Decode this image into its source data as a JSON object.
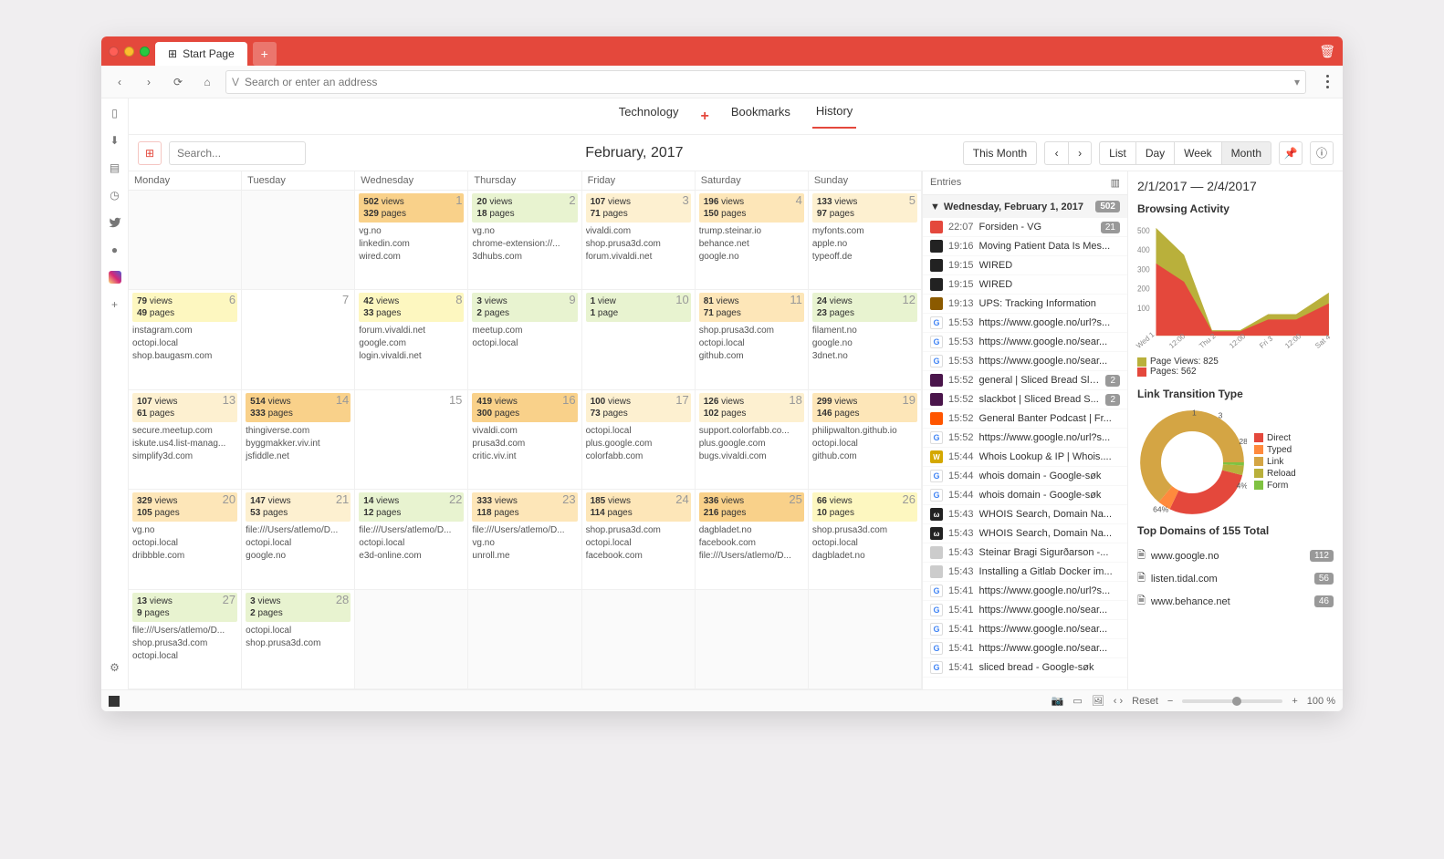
{
  "tab_title": "Start Page",
  "omnibox_placeholder": "Search or enter an address",
  "topnav": [
    "Technology",
    "Bookmarks",
    "History"
  ],
  "topnav_active": "History",
  "search_placeholder": "Search...",
  "month_title": "February, 2017",
  "this_month": "This Month",
  "view_modes": [
    "List",
    "Day",
    "Week",
    "Month"
  ],
  "view_active": "Month",
  "day_headers": [
    "Monday",
    "Tuesday",
    "Wednesday",
    "Thursday",
    "Friday",
    "Saturday",
    "Sunday"
  ],
  "days": [
    {
      "n": "",
      "empty": true
    },
    {
      "n": "",
      "empty": true
    },
    {
      "n": "1",
      "v": "502",
      "p": "329",
      "cls": "o1",
      "sites": [
        "vg.no",
        "linkedin.com",
        "wired.com"
      ]
    },
    {
      "n": "2",
      "v": "20",
      "p": "18",
      "cls": "g1",
      "sites": [
        "vg.no",
        "chrome-extension://...",
        "3dhubs.com"
      ]
    },
    {
      "n": "3",
      "v": "107",
      "p": "71",
      "cls": "o3",
      "sites": [
        "vivaldi.com",
        "shop.prusa3d.com",
        "forum.vivaldi.net"
      ]
    },
    {
      "n": "4",
      "v": "196",
      "p": "150",
      "cls": "o2",
      "sites": [
        "trump.steinar.io",
        "behance.net",
        "google.no"
      ]
    },
    {
      "n": "5",
      "v": "133",
      "p": "97",
      "cls": "o3",
      "sites": [
        "myfonts.com",
        "apple.no",
        "typeoff.de"
      ]
    },
    {
      "n": "6",
      "v": "79",
      "p": "49",
      "cls": "y1",
      "sites": [
        "instagram.com",
        "octopi.local",
        "shop.baugasm.com"
      ]
    },
    {
      "n": "7",
      "empty": true
    },
    {
      "n": "8",
      "v": "42",
      "p": "33",
      "cls": "y1",
      "sites": [
        "forum.vivaldi.net",
        "google.com",
        "login.vivaldi.net"
      ]
    },
    {
      "n": "9",
      "v": "3",
      "p": "2",
      "cls": "g1",
      "sites": [
        "meetup.com",
        "octopi.local"
      ]
    },
    {
      "n": "10",
      "v": "1",
      "p": "1",
      "cls": "g1",
      "sv": "view",
      "sp": "page",
      "sites": []
    },
    {
      "n": "11",
      "v": "81",
      "p": "71",
      "cls": "o2",
      "sites": [
        "shop.prusa3d.com",
        "octopi.local",
        "github.com"
      ]
    },
    {
      "n": "12",
      "v": "24",
      "p": "23",
      "cls": "g1",
      "sites": [
        "filament.no",
        "google.no",
        "3dnet.no"
      ]
    },
    {
      "n": "13",
      "v": "107",
      "p": "61",
      "cls": "o3",
      "sites": [
        "secure.meetup.com",
        "iskute.us4.list-manag...",
        "simplify3d.com"
      ]
    },
    {
      "n": "14",
      "v": "514",
      "p": "333",
      "cls": "o1",
      "sites": [
        "thingiverse.com",
        "byggmakker.viv.int",
        "jsfiddle.net"
      ]
    },
    {
      "n": "15",
      "empty": true
    },
    {
      "n": "16",
      "v": "419",
      "p": "300",
      "cls": "o1",
      "sites": [
        "vivaldi.com",
        "prusa3d.com",
        "critic.viv.int"
      ]
    },
    {
      "n": "17",
      "v": "100",
      "p": "73",
      "cls": "o3",
      "sites": [
        "octopi.local",
        "plus.google.com",
        "colorfabb.com"
      ]
    },
    {
      "n": "18",
      "v": "126",
      "p": "102",
      "cls": "o3",
      "sites": [
        "support.colorfabb.co...",
        "plus.google.com",
        "bugs.vivaldi.com"
      ]
    },
    {
      "n": "19",
      "v": "299",
      "p": "146",
      "cls": "o2",
      "sites": [
        "philipwalton.github.io",
        "octopi.local",
        "github.com"
      ]
    },
    {
      "n": "20",
      "v": "329",
      "p": "105",
      "cls": "o2",
      "sites": [
        "vg.no",
        "octopi.local",
        "dribbble.com"
      ]
    },
    {
      "n": "21",
      "v": "147",
      "p": "53",
      "cls": "o3",
      "sites": [
        "file:///Users/atlemo/D...",
        "octopi.local",
        "google.no"
      ]
    },
    {
      "n": "22",
      "v": "14",
      "p": "12",
      "cls": "g1",
      "sites": [
        "file:///Users/atlemo/D...",
        "octopi.local",
        "e3d-online.com"
      ]
    },
    {
      "n": "23",
      "v": "333",
      "p": "118",
      "cls": "o2",
      "sites": [
        "file:///Users/atlemo/D...",
        "vg.no",
        "unroll.me"
      ]
    },
    {
      "n": "24",
      "v": "185",
      "p": "114",
      "cls": "o2",
      "sites": [
        "shop.prusa3d.com",
        "octopi.local",
        "facebook.com"
      ]
    },
    {
      "n": "25",
      "v": "336",
      "p": "216",
      "cls": "o1",
      "sites": [
        "dagbladet.no",
        "facebook.com",
        "file:///Users/atlemo/D..."
      ]
    },
    {
      "n": "26",
      "v": "66",
      "p": "10",
      "cls": "y1",
      "sites": [
        "shop.prusa3d.com",
        "octopi.local",
        "dagbladet.no"
      ]
    },
    {
      "n": "27",
      "v": "13",
      "p": "9",
      "cls": "g1",
      "sites": [
        "file:///Users/atlemo/D...",
        "shop.prusa3d.com",
        "octopi.local"
      ]
    },
    {
      "n": "28",
      "v": "3",
      "p": "2",
      "cls": "g1",
      "sites": [
        "octopi.local",
        "shop.prusa3d.com"
      ]
    },
    {
      "n": "",
      "empty": true
    },
    {
      "n": "",
      "empty": true
    },
    {
      "n": "",
      "empty": true
    },
    {
      "n": "",
      "empty": true
    },
    {
      "n": "",
      "empty": true
    }
  ],
  "entries_header": "Entries",
  "entries_date": "Wednesday, February 1, 2017",
  "entries_count": "502",
  "entries": [
    {
      "t": "22:07",
      "title": "Forsiden - VG",
      "fav": "#e4483c",
      "badge": "21"
    },
    {
      "t": "19:16",
      "title": "Moving Patient Data Is Mes...",
      "fav": "#222"
    },
    {
      "t": "19:15",
      "title": "WIRED",
      "fav": "#222"
    },
    {
      "t": "19:15",
      "title": "WIRED",
      "fav": "#222"
    },
    {
      "t": "19:13",
      "title": "UPS: Tracking Information",
      "fav": "#8b5a00"
    },
    {
      "t": "15:53",
      "title": "https://www.google.no/url?s...",
      "fav": "g"
    },
    {
      "t": "15:53",
      "title": "https://www.google.no/sear...",
      "fav": "g"
    },
    {
      "t": "15:53",
      "title": "https://www.google.no/sear...",
      "fav": "g"
    },
    {
      "t": "15:52",
      "title": "general | Sliced Bread Sla...",
      "fav": "#4a154b",
      "badge": "2"
    },
    {
      "t": "15:52",
      "title": "slackbot | Sliced Bread S...",
      "fav": "#4a154b",
      "badge": "2"
    },
    {
      "t": "15:52",
      "title": "General Banter Podcast | Fr...",
      "fav": "#ff5500"
    },
    {
      "t": "15:52",
      "title": "https://www.google.no/url?s...",
      "fav": "g"
    },
    {
      "t": "15:44",
      "title": "Whois Lookup & IP | Whois....",
      "fav": "#d4a800",
      "txt": "W"
    },
    {
      "t": "15:44",
      "title": "whois domain - Google-søk",
      "fav": "g"
    },
    {
      "t": "15:44",
      "title": "whois domain - Google-søk",
      "fav": "g"
    },
    {
      "t": "15:43",
      "title": "WHOIS Search, Domain Na...",
      "fav": "#222",
      "txt": "ω"
    },
    {
      "t": "15:43",
      "title": "WHOIS Search, Domain Na...",
      "fav": "#222",
      "txt": "ω"
    },
    {
      "t": "15:43",
      "title": "Steinar Bragi Sigurðarson -...",
      "fav": "#ccc"
    },
    {
      "t": "15:43",
      "title": "Installing a Gitlab Docker im...",
      "fav": "#ccc"
    },
    {
      "t": "15:41",
      "title": "https://www.google.no/url?s...",
      "fav": "g"
    },
    {
      "t": "15:41",
      "title": "https://www.google.no/sear...",
      "fav": "g"
    },
    {
      "t": "15:41",
      "title": "https://www.google.no/sear...",
      "fav": "g"
    },
    {
      "t": "15:41",
      "title": "https://www.google.no/sear...",
      "fav": "g"
    },
    {
      "t": "15:41",
      "title": "sliced bread - Google-søk",
      "fav": "g"
    }
  ],
  "range": "2/1/2017 — 2/4/2017",
  "activity_title": "Browsing Activity",
  "chart_data": {
    "type": "area",
    "title": "Browsing Activity",
    "ylim": [
      0,
      500
    ],
    "yticks": [
      100,
      200,
      300,
      400,
      500
    ],
    "x": [
      "Wed 1",
      "12:00",
      "Thu 2",
      "12:00",
      "Fri 3",
      "12:00",
      "Sat 4"
    ],
    "series": [
      {
        "name": "Page Views",
        "color": "#b9b03b",
        "values": [
          500,
          370,
          20,
          20,
          95,
          95,
          200
        ]
      },
      {
        "name": "Pages",
        "color": "#e4483c",
        "values": [
          330,
          250,
          18,
          18,
          72,
          72,
          150
        ]
      }
    ]
  },
  "legend_pv": "Page Views: 825",
  "legend_pg": "Pages: 562",
  "transition_title": "Link Transition Type",
  "donut_data": {
    "type": "pie",
    "series": [
      {
        "name": "Direct",
        "pct": 28,
        "color": "#e4483c"
      },
      {
        "name": "Typed",
        "pct": 4,
        "color": "#ff8a3d"
      },
      {
        "name": "Link",
        "pct": 64,
        "color": "#d4a544"
      },
      {
        "name": "Reload",
        "pct": 3,
        "color": "#b9b03b"
      },
      {
        "name": "Form",
        "pct": 1,
        "color": "#7fc241"
      }
    ],
    "labels": [
      "1",
      "3",
      "28%",
      "4%",
      "64%"
    ]
  },
  "topdom_title": "Top Domains of 155 Total",
  "topdom": [
    {
      "name": "www.google.no",
      "n": "112"
    },
    {
      "name": "listen.tidal.com",
      "n": "56"
    },
    {
      "name": "www.behance.net",
      "n": "46"
    }
  ],
  "status_reset": "Reset",
  "status_zoom": "100 %"
}
